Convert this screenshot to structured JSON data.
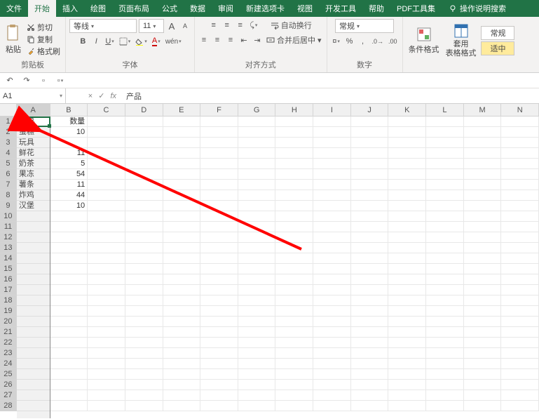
{
  "menu": {
    "tabs": [
      "文件",
      "开始",
      "插入",
      "绘图",
      "页面布局",
      "公式",
      "数据",
      "审阅",
      "新建选项卡",
      "视图",
      "开发工具",
      "帮助",
      "PDF工具集"
    ],
    "active_index": 1,
    "tell_me": "操作说明搜索"
  },
  "ribbon": {
    "clipboard": {
      "paste": "粘贴",
      "cut": "剪切",
      "copy": "复制",
      "painter": "格式刷",
      "label": "剪贴板"
    },
    "font": {
      "name": "等线",
      "size": "11",
      "label": "字体"
    },
    "align": {
      "wrap": "自动换行",
      "merge": "合并后居中",
      "label": "对齐方式"
    },
    "number": {
      "format": "常规",
      "label": "数字"
    },
    "styles": {
      "cond": "条件格式",
      "table": "套用\n表格格式",
      "good": "常规",
      "neutral": "适中"
    }
  },
  "qat": {},
  "formula": {
    "name": "A1",
    "fx": "fx",
    "value": "产品"
  },
  "sheet": {
    "cols": [
      "A",
      "B",
      "C",
      "D",
      "E",
      "F",
      "G",
      "H",
      "I",
      "J",
      "K",
      "L",
      "M",
      "N"
    ],
    "rows": [
      {
        "n": 1,
        "a": "产品",
        "b": "数量"
      },
      {
        "n": 2,
        "a": "蛋糕",
        "b": "10"
      },
      {
        "n": 3,
        "a": "玩具",
        "b": ""
      },
      {
        "n": 4,
        "a": "鲜花",
        "b": "11"
      },
      {
        "n": 5,
        "a": "奶茶",
        "b": "5"
      },
      {
        "n": 6,
        "a": "果冻",
        "b": "54"
      },
      {
        "n": 7,
        "a": "薯条",
        "b": "11"
      },
      {
        "n": 8,
        "a": "炸鸡",
        "b": "44"
      },
      {
        "n": 9,
        "a": "汉堡",
        "b": "10"
      },
      {
        "n": 10,
        "a": "",
        "b": ""
      },
      {
        "n": 11,
        "a": "",
        "b": ""
      },
      {
        "n": 12,
        "a": "",
        "b": ""
      },
      {
        "n": 13,
        "a": "",
        "b": ""
      },
      {
        "n": 14,
        "a": "",
        "b": ""
      },
      {
        "n": 15,
        "a": "",
        "b": ""
      },
      {
        "n": 16,
        "a": "",
        "b": ""
      },
      {
        "n": 17,
        "a": "",
        "b": ""
      },
      {
        "n": 18,
        "a": "",
        "b": ""
      },
      {
        "n": 19,
        "a": "",
        "b": ""
      },
      {
        "n": 20,
        "a": "",
        "b": ""
      },
      {
        "n": 21,
        "a": "",
        "b": ""
      },
      {
        "n": 22,
        "a": "",
        "b": ""
      },
      {
        "n": 23,
        "a": "",
        "b": ""
      },
      {
        "n": 24,
        "a": "",
        "b": ""
      },
      {
        "n": 25,
        "a": "",
        "b": ""
      },
      {
        "n": 26,
        "a": "",
        "b": ""
      },
      {
        "n": 27,
        "a": "",
        "b": ""
      },
      {
        "n": 28,
        "a": "",
        "b": ""
      }
    ],
    "active": "产品"
  }
}
